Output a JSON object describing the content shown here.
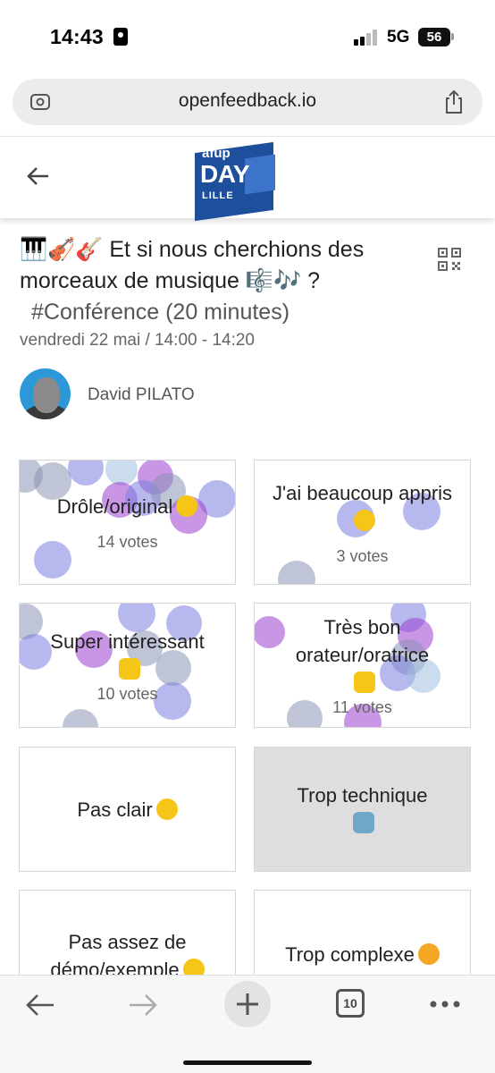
{
  "status_bar": {
    "time": "14:43",
    "network": "5G",
    "battery": "56"
  },
  "browser": {
    "url": "openfeedback.io",
    "tab_count": "10"
  },
  "header": {
    "logo": {
      "afup": "afup",
      "day": "DAY",
      "city": "LILLE"
    }
  },
  "talk": {
    "title": "🎹🎻🎸 Et si nous cherchions des morceaux de musique 🎼🎶 ?",
    "tag": "#Conférence (20 minutes)",
    "date": "vendredi 22 mai / 14:00 - 14:20",
    "speaker": "David PILATO"
  },
  "votes": [
    {
      "label": "Drôle/original",
      "emoji": "grinning-face",
      "votes": "14 votes"
    },
    {
      "label": "J'ai beaucoup appris",
      "emoji": "nerd-face",
      "votes": "3 votes"
    },
    {
      "label": "Super intéressant",
      "emoji": "thumbs-up",
      "votes": "10 votes"
    },
    {
      "label": "Très bon orateur/oratrice",
      "emoji": "clapping-hands",
      "votes": "11 votes"
    },
    {
      "label": "Pas clair",
      "emoji": "monocle-face",
      "votes": ""
    },
    {
      "label": "Trop technique",
      "emoji": "robot",
      "votes": "",
      "selected": true
    },
    {
      "label": "Pas assez de démo/exemple",
      "emoji": "thinking-face",
      "votes": ""
    },
    {
      "label": "Trop complexe",
      "emoji": "exploding-head",
      "votes": ""
    }
  ],
  "colors": {
    "bubble_blue": "#7b7fe0",
    "bubble_purple": "#9b3fd0",
    "bubble_gray": "#8a93b5",
    "selected_card": "#dedede",
    "logo_blue": "#1e4f9c"
  }
}
